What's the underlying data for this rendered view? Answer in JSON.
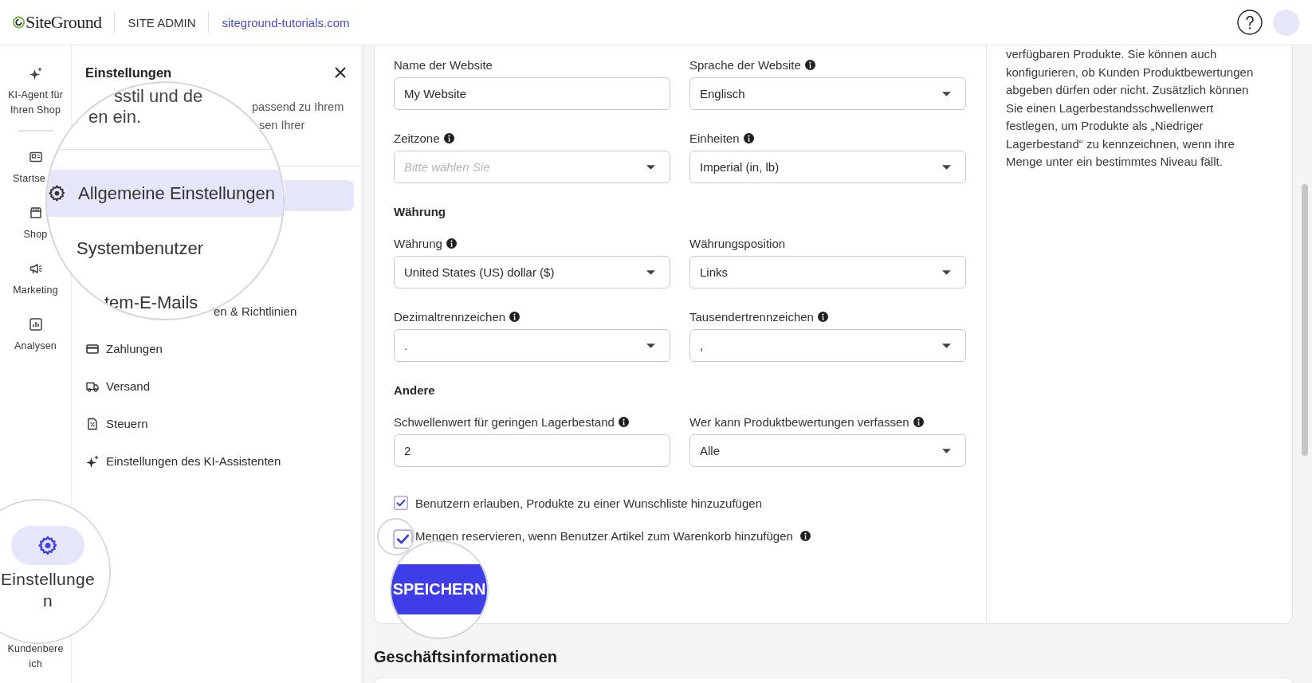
{
  "header": {
    "logo": "SiteGround",
    "section": "SITE ADMIN",
    "site_link": "siteground-tutorials.com"
  },
  "rail": {
    "items": [
      {
        "label": "KI-Agent für Ihren Shop",
        "selected": false
      },
      {
        "label": "Startse",
        "selected": false
      },
      {
        "label": "Shop",
        "selected": false
      },
      {
        "label": "Marketing",
        "selected": false
      },
      {
        "label": "Analysen",
        "selected": false
      }
    ],
    "bottom_items": [
      {
        "label": "Kundenbereich",
        "selected": false
      }
    ]
  },
  "settings_panel": {
    "title": "Einstellungen",
    "description_fragments": [
      "passend zu Ihrem",
      "sen Ihrer"
    ],
    "partial_item": "en & Richtlinien",
    "items": [
      {
        "label": "Zahlungen",
        "selected": false
      },
      {
        "label": "Versand",
        "selected": false
      },
      {
        "label": "Steuern",
        "selected": false
      },
      {
        "label": "Einstellungen des KI-Assistenten",
        "selected": false
      }
    ]
  },
  "panel_lens": {
    "texts": [
      "sstil und de",
      "en ein."
    ],
    "items": [
      {
        "label": "Allgemeine Einstellungen",
        "selected": true
      },
      {
        "label": "Systembenutzer",
        "selected": false
      },
      {
        "label": "tem-E-Mails",
        "selected": false
      }
    ]
  },
  "rail_lens": {
    "item": {
      "label": "Einstellungen",
      "selected": true
    }
  },
  "form": {
    "rows": [
      {
        "kind": "fields",
        "fields": [
          {
            "kind": "text",
            "label": "Name der Website",
            "info": false,
            "value": "My Website"
          },
          {
            "kind": "select",
            "label": "Sprache der Website",
            "info": true,
            "value": "Englisch"
          }
        ]
      },
      {
        "kind": "fields",
        "fields": [
          {
            "kind": "select",
            "label": "Zeitzone",
            "info": true,
            "placeholder": "Bitte wählen Sie"
          },
          {
            "kind": "select",
            "label": "Einheiten",
            "info": true,
            "value": "Imperial (in, lb)"
          }
        ]
      },
      {
        "kind": "heading",
        "text": "Währung"
      },
      {
        "kind": "fields",
        "fields": [
          {
            "kind": "select",
            "label": "Währung",
            "info": true,
            "value": "United States (US) dollar ($)"
          },
          {
            "kind": "select",
            "label": "Währungsposition",
            "info": false,
            "value": "Links"
          }
        ]
      },
      {
        "kind": "fields",
        "fields": [
          {
            "kind": "select",
            "label": "Dezimaltrennzeichen",
            "info": true,
            "value": "."
          },
          {
            "kind": "select",
            "label": "Tausendertrennzeichen",
            "info": true,
            "value": ","
          }
        ]
      },
      {
        "kind": "heading",
        "text": "Andere"
      },
      {
        "kind": "fields",
        "fields": [
          {
            "kind": "text",
            "label": "Schwellenwert für geringen Lagerbestand",
            "info": true,
            "value": "2"
          },
          {
            "kind": "select",
            "label": "Wer kann Produktbewertungen verfassen",
            "info": true,
            "value": "Alle"
          }
        ]
      }
    ],
    "options": [
      {
        "label": "Benutzern erlauben, Produkte zu einer Wunschliste hinzuzufügen",
        "checked": true,
        "info": false,
        "magnified": false
      },
      {
        "label": "Mengen reservieren, wenn Benutzer Artikel zum Warenkorb hinzufügen",
        "checked": true,
        "info": true,
        "magnified": true
      }
    ],
    "save_button": {
      "label": "SPEICHERN",
      "magnified": true
    }
  },
  "help_text": "verfügbaren Produkte. Sie können auch konfigurieren, ob Kunden Produktbewertungen abgeben dürfen oder nicht. Zusätzlich können Sie einen Lagerbestandsschwellenwert festlegen, um Produkte als „Niedriger Lagerbestand“ zu kennzeichnen, wenn ihre Menge unter ein bestimmtes Niveau fällt.",
  "next_section": {
    "title": "Geschäftsinformationen"
  }
}
